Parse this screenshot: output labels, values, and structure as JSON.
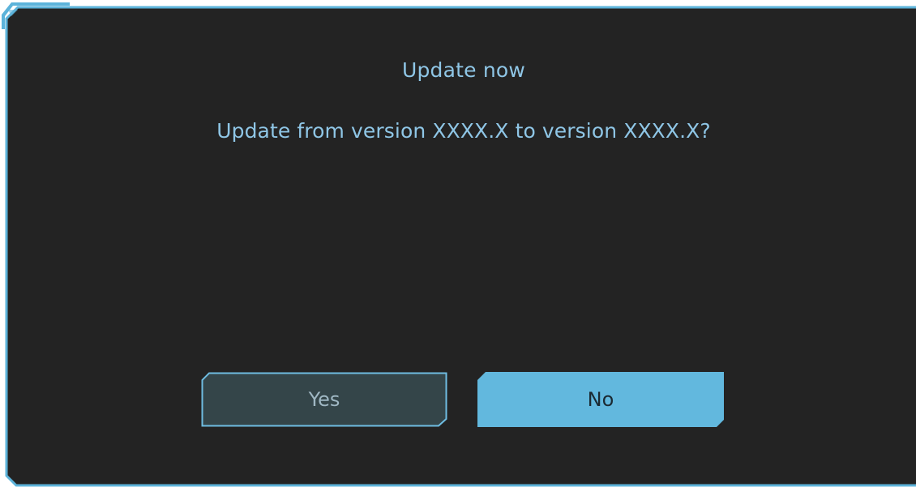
{
  "dialog": {
    "title": "Update now",
    "message": "Update from version XXXX.X to version XXXX.X?",
    "buttons": {
      "yes_label": "Yes",
      "no_label": "No"
    }
  },
  "colors": {
    "background": "#232323",
    "accent": "#62b8de",
    "text": "#8fc6e6",
    "yes_button_fill": "#344549",
    "no_button_fill": "#62b8de"
  },
  "focused_button": "No"
}
